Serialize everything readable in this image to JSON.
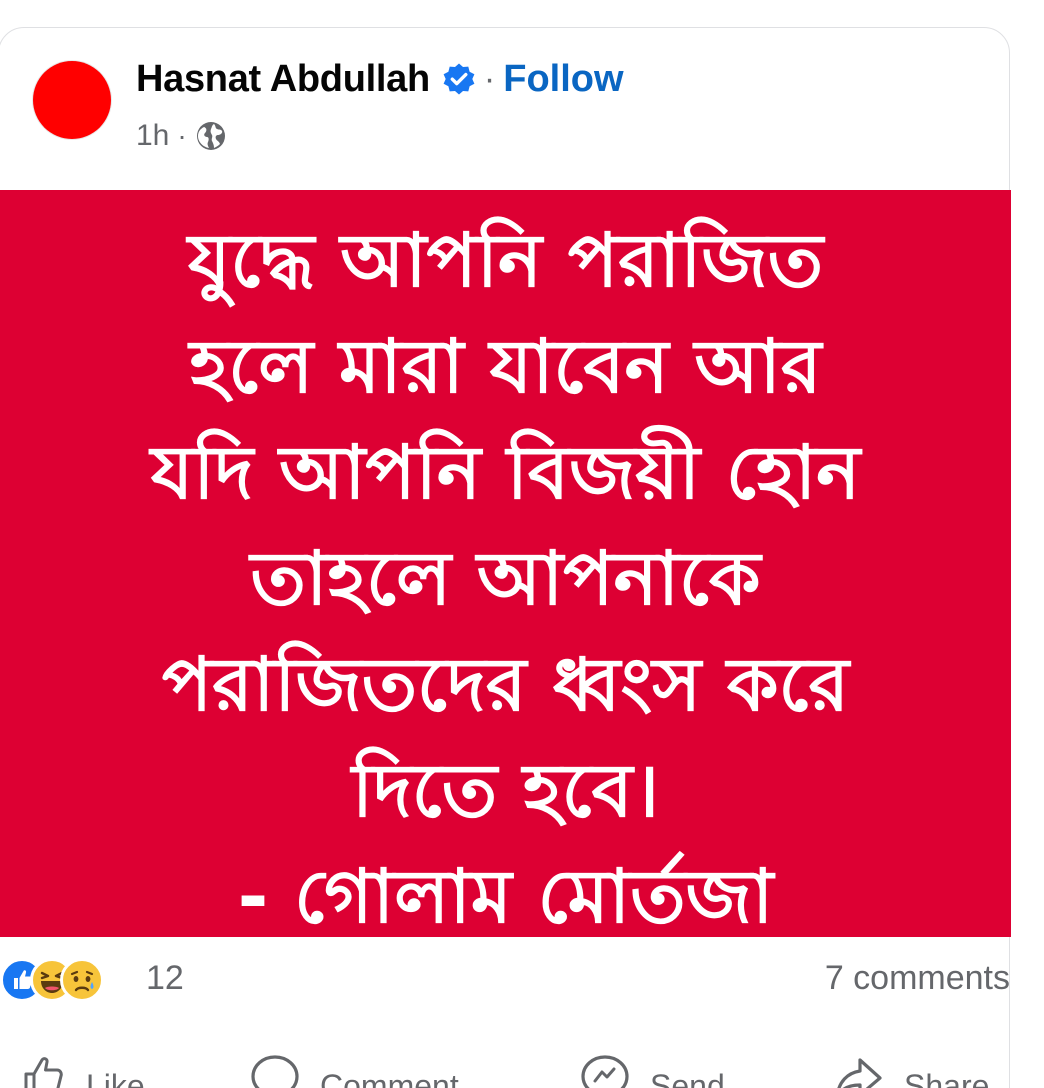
{
  "post": {
    "author": {
      "name": "Hasnat Abdullah",
      "verified_icon": "verified-badge-icon",
      "avatar_color": "#ff0000"
    },
    "follow_label": "Follow",
    "separator": "·",
    "timestamp": "1h",
    "audience_icon": "globe-icon"
  },
  "image": {
    "background_color": "#dd0033",
    "text_color": "#ffffff",
    "lines": [
      "যুদ্ধে আপনি পরাজিত",
      "হলে মারা যাবেন আর",
      "যদি আপনি বিজয়ী হোন",
      "তাহলে আপনাকে",
      "পরাজিতদের ধ্বংস করে",
      "দিতে হবে।",
      "- গোলাম মোর্তজা"
    ]
  },
  "engagement": {
    "reactions": [
      "like-reaction-icon",
      "haha-reaction-icon",
      "sad-reaction-icon"
    ],
    "reaction_count": "12",
    "comments_label": "7 comments"
  },
  "actions": {
    "like": "Like",
    "comment": "Comment",
    "send": "Send",
    "share": "Share"
  },
  "colors": {
    "link_blue": "#0a66c2",
    "secondary_text": "#65676b",
    "like_blue": "#1877f2",
    "emoji_yellow": "#f7c43a"
  }
}
